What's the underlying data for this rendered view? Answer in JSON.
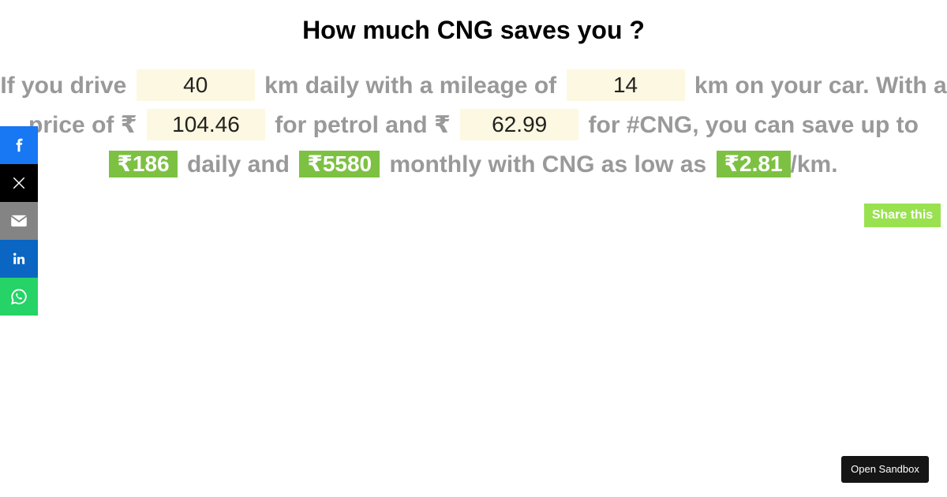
{
  "title": "How much CNG saves you ?",
  "calculator": {
    "text_if_you_drive": "If you drive",
    "km_daily_value": "40",
    "text_km_daily_mileage": "km daily with a mileage of",
    "mileage_value": "14",
    "text_km_on_car": "km on your car. With a price of ₹",
    "petrol_price_value": "104.46",
    "text_for_petrol": "for petrol and ₹",
    "cng_price_value": "62.99",
    "text_for_cng": "for #CNG, you can save up to",
    "daily_savings": "₹186",
    "text_daily_and": "daily and",
    "monthly_savings": "₹5580",
    "text_monthly_low": "monthly with CNG as low as",
    "cost_per_km": "₹2.81",
    "text_per_km": "/km."
  },
  "share_this_label": "Share this",
  "social": {
    "items": [
      {
        "name": "facebook",
        "icon": "facebook-icon",
        "color": "#1877f2"
      },
      {
        "name": "x",
        "icon": "x-icon",
        "color": "#000000"
      },
      {
        "name": "email",
        "icon": "email-icon",
        "color": "#848484"
      },
      {
        "name": "linkedin",
        "icon": "linkedin-icon",
        "color": "#0a66c2"
      },
      {
        "name": "whatsapp",
        "icon": "whatsapp-icon",
        "color": "#25d366"
      }
    ]
  },
  "sandbox_label": "Open Sandbox",
  "colors": {
    "input_bg": "#fdf8e1",
    "result_bg": "#7dc142",
    "share_bg": "#9ae14f",
    "text_gray": "#999999"
  }
}
